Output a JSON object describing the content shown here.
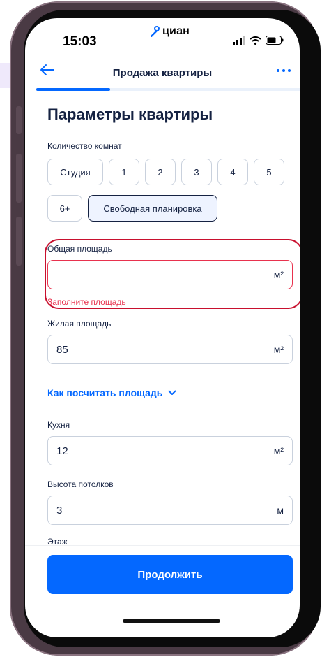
{
  "status_bar": {
    "time": "15:03",
    "logo_text": "циан"
  },
  "header": {
    "title": "Продажа квартиры",
    "progress": 0.28
  },
  "page": {
    "title": "Параметры квартиры"
  },
  "rooms": {
    "label": "Количество комнат",
    "options": [
      "Студия",
      "1",
      "2",
      "3",
      "4",
      "5",
      "6+",
      "Свободная планировка"
    ],
    "selected": "Свободная планировка"
  },
  "total_area": {
    "label": "Общая площадь",
    "value": "",
    "unit": "м²",
    "error": "Заполните площадь"
  },
  "living_area": {
    "label": "Жилая площадь",
    "value": "85",
    "unit": "м²"
  },
  "how_to_link": "Как посчитать площадь",
  "kitchen": {
    "label": "Кухня",
    "value": "12",
    "unit": "м²"
  },
  "ceiling": {
    "label": "Высота потолков",
    "value": "3",
    "unit": "м"
  },
  "floor": {
    "label": "Этаж"
  },
  "continue_button": "Продолжить",
  "colors": {
    "accent": "#0468ff",
    "error": "#e8324e",
    "text": "#152242",
    "annotation": "#c8102e"
  }
}
